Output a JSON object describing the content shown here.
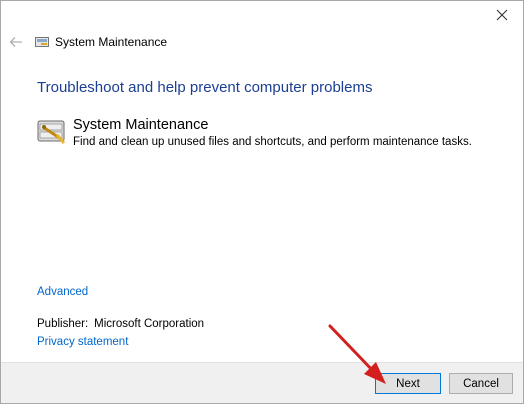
{
  "window": {
    "title": "System Maintenance",
    "close_label": "✕"
  },
  "main": {
    "heading": "Troubleshoot and help prevent computer problems",
    "item": {
      "title": "System Maintenance",
      "description": "Find and clean up unused files and shortcuts, and perform maintenance tasks."
    },
    "advanced_link": "Advanced",
    "publisher_label": "Publisher:",
    "publisher_value": "Microsoft Corporation",
    "privacy_link": "Privacy statement"
  },
  "footer": {
    "next_label": "Next",
    "cancel_label": "Cancel"
  },
  "colors": {
    "heading": "#1c3f94",
    "link": "#0066cc",
    "annotation_arrow": "#d41f1f",
    "button_focus": "#0078d7"
  },
  "icons": [
    "close-icon",
    "back-arrow-icon",
    "troubleshooter-icon",
    "maintenance-icon",
    "annotation-arrow"
  ]
}
